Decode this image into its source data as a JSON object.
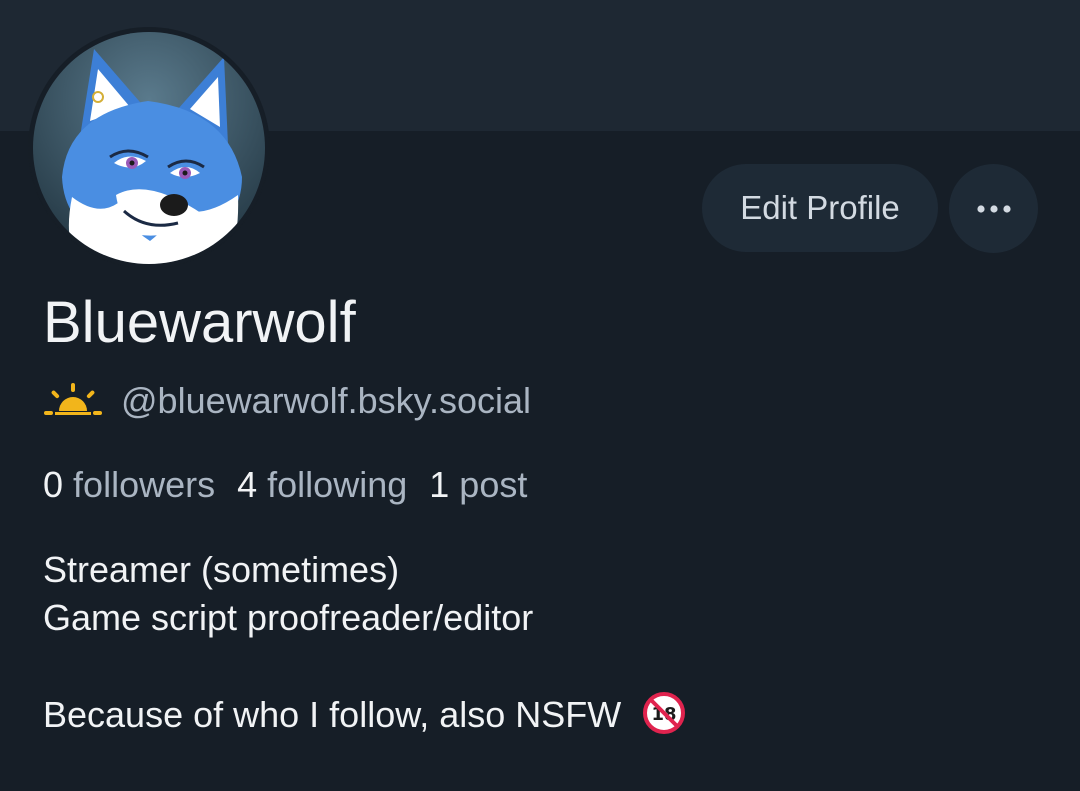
{
  "profile": {
    "display_name": "Bluewarwolf",
    "handle": "@bluewarwolf.bsky.social",
    "handle_icon": "sunrise-icon",
    "avatar_icon": "blue-wolf-avatar"
  },
  "actions": {
    "edit_profile_label": "Edit Profile",
    "more_icon": "more-horizontal-icon"
  },
  "stats": {
    "followers_count": "0",
    "followers_label": "followers",
    "following_count": "4",
    "following_label": "following",
    "posts_count": "1",
    "posts_label": "post"
  },
  "bio": {
    "line1": "Streamer (sometimes)",
    "line2": "Game script proofreader/editor",
    "line3": "Because of who I follow, also NSFW",
    "line3_emoji": "no-under-18-icon"
  },
  "colors": {
    "background": "#161e27",
    "banner": "#1e2833",
    "button": "#1e2a36",
    "muted_text": "#aab5c2",
    "sun_yellow": "#f2b51b",
    "nsfw_red": "#e0234e"
  }
}
